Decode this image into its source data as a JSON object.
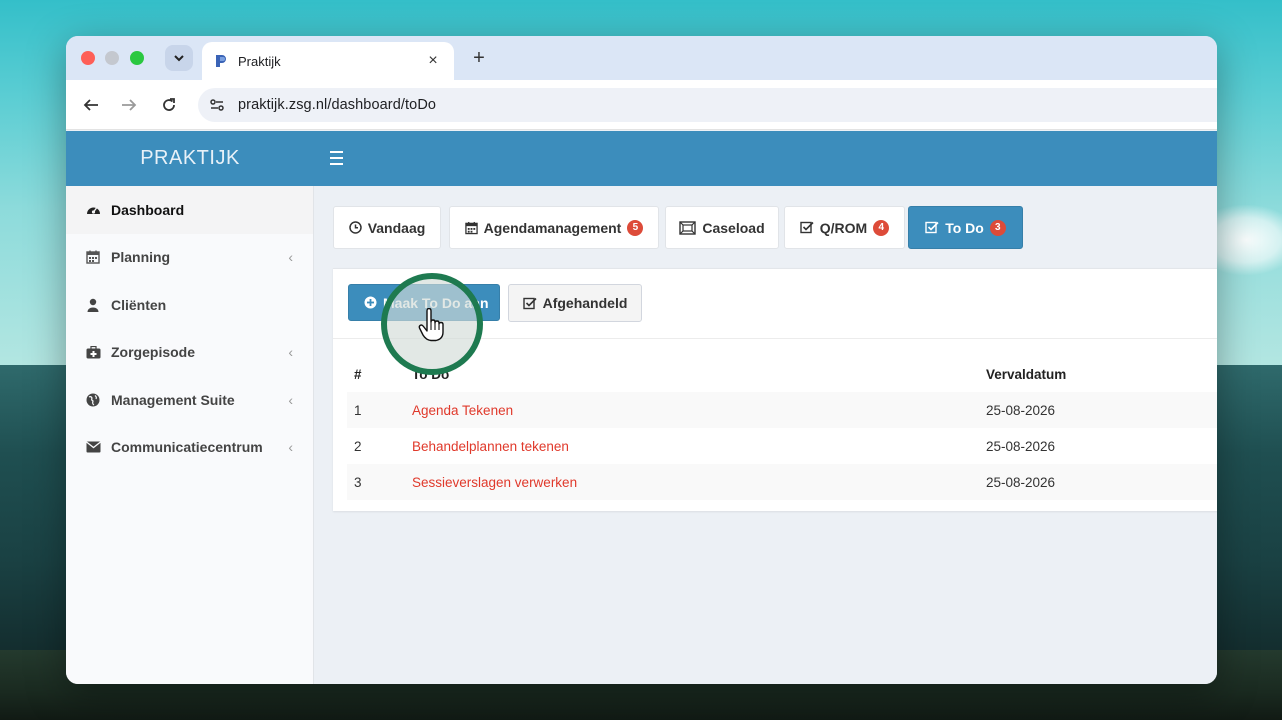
{
  "browser": {
    "tab_title": "Praktijk",
    "new_tab_symbol": "+",
    "close_symbol": "×",
    "url": "praktijk.zsg.nl/dashboard/toDo"
  },
  "app": {
    "logo": "PRAKTIJK",
    "accent_color": "#3c8dbc"
  },
  "sidebar": {
    "items": [
      {
        "label": "Dashboard",
        "icon": "dashboard-icon",
        "has_submenu": false
      },
      {
        "label": "Planning",
        "icon": "calendar-icon",
        "has_submenu": true
      },
      {
        "label": "Cliënten",
        "icon": "user-icon",
        "has_submenu": false
      },
      {
        "label": "Zorgepisode",
        "icon": "medkit-icon",
        "has_submenu": true
      },
      {
        "label": "Management Suite",
        "icon": "globe-icon",
        "has_submenu": true
      },
      {
        "label": "Communicatiecentrum",
        "icon": "envelope-icon",
        "has_submenu": true
      }
    ],
    "chevron": "‹"
  },
  "tabs": [
    {
      "label": "Vandaag",
      "icon": "clock-icon"
    },
    {
      "label": "Agendamanagement",
      "icon": "calendar-icon",
      "badge": "5"
    },
    {
      "label": "Caseload",
      "icon": "caseload-icon"
    },
    {
      "label": "Q/ROM",
      "icon": "check-square-icon",
      "badge": "4"
    },
    {
      "label": "To Do",
      "icon": "check-square-icon",
      "badge": "3",
      "active": true
    }
  ],
  "actions": {
    "add_label": "Maak To Do aan",
    "done_label": "Afgehandeld"
  },
  "table": {
    "headers": [
      "#",
      "To Do",
      "Vervaldatum"
    ],
    "rows": [
      {
        "num": "1",
        "todo": "Agenda Tekenen",
        "due": "25-08-2026"
      },
      {
        "num": "2",
        "todo": "Behandelplannen tekenen",
        "due": "25-08-2026"
      },
      {
        "num": "3",
        "todo": "Sessieverslagen verwerken",
        "due": "25-08-2026"
      }
    ]
  }
}
